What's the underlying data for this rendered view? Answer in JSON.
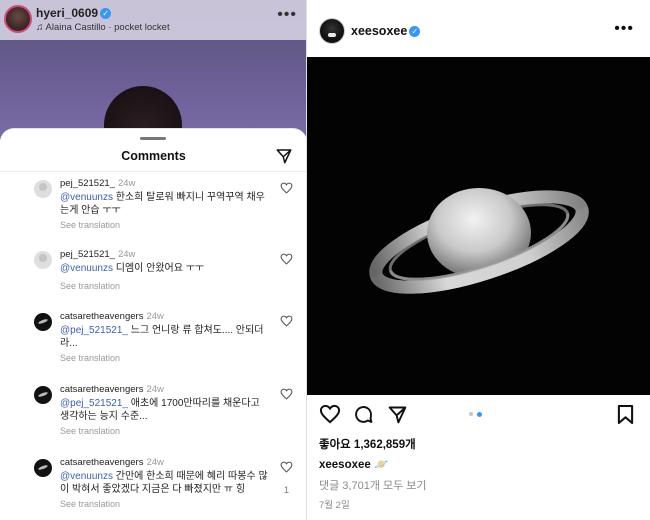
{
  "story": {
    "username": "hyeri_0609",
    "music": "Alaina Castillo · pocket locket"
  },
  "comments_sheet": {
    "title": "Comments",
    "items": [
      {
        "username": "pej_521521_",
        "time": "24w",
        "mention": "@venuunzs",
        "text": " 한소희 탈로워 빠지니 꾸역꾸역 채우는게 안습 ㅜㅜ",
        "translate": "See translation",
        "avatar": "gray"
      },
      {
        "username": "pej_521521_",
        "time": "24w",
        "mention": "@venuunzs",
        "text": " 디엠이 안왔어요 ㅜㅜ",
        "translate": "See translation",
        "avatar": "gray"
      },
      {
        "username": "catsaretheavengers",
        "time": "24w",
        "mention": "@pej_521521_",
        "text": " 느그 언니랑 류 합쳐도.... 안되더라...",
        "translate": "See translation",
        "avatar": "dark"
      },
      {
        "username": "catsaretheavengers",
        "time": "24w",
        "mention": "@pej_521521_",
        "text": " 애초에 1700만따리를 채운다고 생각하는 능지 수준...",
        "translate": "See translation",
        "avatar": "dark"
      },
      {
        "username": "catsaretheavengers",
        "time": "24w",
        "mention": "@venuunzs",
        "text": " 간만에 한소희 때문에 혜리 따봉수 많이 박혀서 좋았겠다 지금은 다 빠졌지만 ㅠ 힝",
        "translate": "See translation",
        "avatar": "dark",
        "likes": "1"
      }
    ]
  },
  "post": {
    "username": "xeesoxee",
    "likes_text": "좋아요 1,362,859개",
    "caption_user": "xeesoxee",
    "caption_text": " 🪐",
    "view_comments": "댓글 3,701개 모두 보기",
    "date": "7월 2일"
  },
  "colors": {
    "verified": "#3897f0",
    "mention": "#3b5fae",
    "muted": "#8a8a8a"
  }
}
